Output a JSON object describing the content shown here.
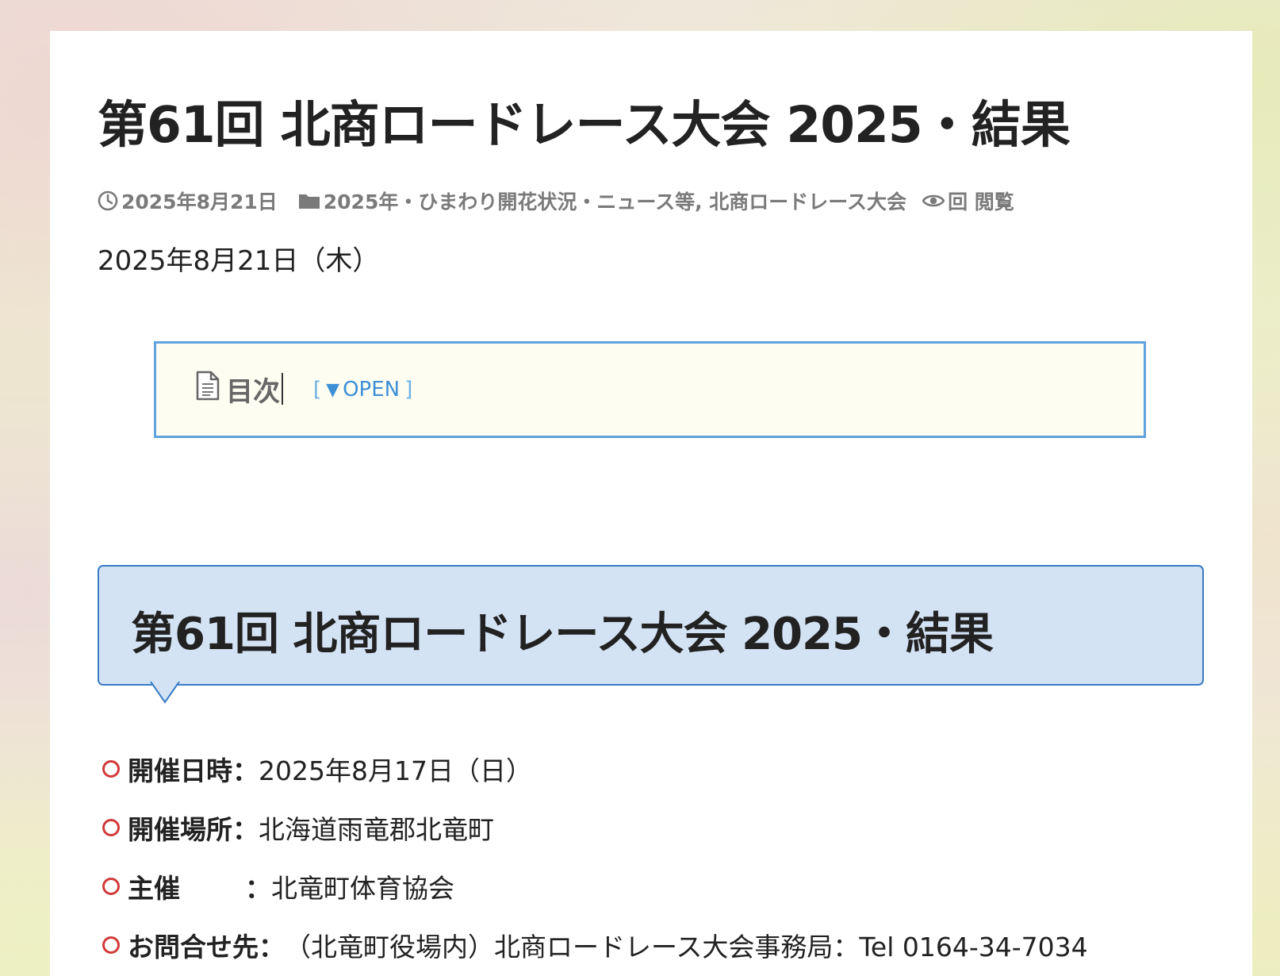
{
  "post": {
    "title": "第61回 北商ロードレース大会 2025・結果",
    "meta": {
      "date": "2025年8月21日",
      "categories": "2025年・ひまわり開花状況・ニュース等, 北商ロードレース大会",
      "views": "回 閲覧",
      "icons": [
        "clock-icon",
        "folder-icon",
        "eye-icon"
      ]
    },
    "date_line": "2025年8月21日（木）"
  },
  "toc": {
    "title": "目次",
    "toggle_open_bracket": "[",
    "toggle_arrow": "▼",
    "toggle_label": "OPEN",
    "toggle_close_bracket": "]"
  },
  "section": {
    "heading": "第61回 北商ロードレース大会 2025・結果",
    "items": [
      {
        "label": "開催日時",
        "sep": "：",
        "value": "2025年8月17日（日）"
      },
      {
        "label": "開催場所",
        "sep": "：",
        "value": "北海道雨竜郡北竜町"
      },
      {
        "label": "主催",
        "sep": "：",
        "value": "北竜町体育協会"
      },
      {
        "label": "お問合せ先",
        "sep": "：",
        "value": "（北竜町役場内）北商ロードレース大会事務局：Tel 0164-34-7034"
      }
    ]
  },
  "colors": {
    "accent_blue": "#5fa2dd",
    "heading_bg": "#d4e3f4",
    "bullet_red": "#d13a3a"
  }
}
